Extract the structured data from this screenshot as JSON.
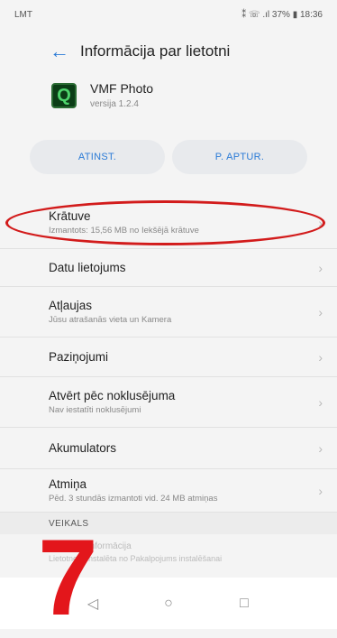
{
  "status_bar": {
    "carrier": "LMT",
    "right": "⁑ ☏ .ıl 37% ▮ 18:36"
  },
  "app_bar": {
    "title": "Informācija par lietotni"
  },
  "app": {
    "name": "VMF Photo",
    "version": "versija 1.2.4",
    "icon_letter": "Q"
  },
  "buttons": {
    "uninstall": "ATINST.",
    "force_stop": "P. APTUR."
  },
  "list": [
    {
      "title": "Krātuve",
      "subtitle": "Izmantots: 15,56 MB no Iekšējā krātuve"
    },
    {
      "title": "Datu lietojums",
      "subtitle": ""
    },
    {
      "title": "Atļaujas",
      "subtitle": "Jūsu atrašanās vieta un Kamera"
    },
    {
      "title": "Paziņojumi",
      "subtitle": ""
    },
    {
      "title": "Atvērt pēc noklusējuma",
      "subtitle": "Nav iestatīti noklusējumi"
    },
    {
      "title": "Akumulators",
      "subtitle": ""
    },
    {
      "title": "Atmiņa",
      "subtitle": "Pēd. 3 stundās izmantoti vid. 24 MB atmiņas"
    }
  ],
  "section": {
    "header": "VEIKALS",
    "item_title": "Lietotnes informācija",
    "item_subtitle": "Lietotne ir instalēta no Pakalpojums instalēšanai"
  },
  "annotation": {
    "step": "7"
  },
  "colors": {
    "accent": "#2b7bd6",
    "highlight": "#d21b1b"
  }
}
